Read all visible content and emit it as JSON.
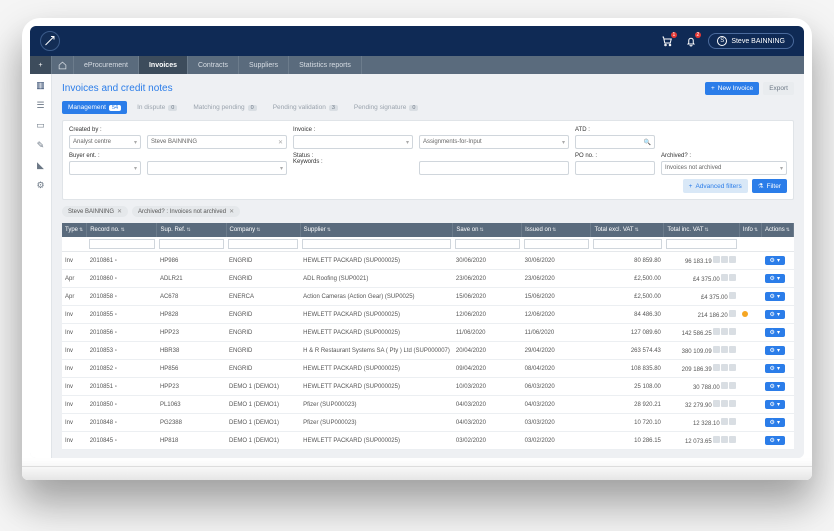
{
  "user": {
    "name": "Steve BAINNING",
    "initial": "S"
  },
  "header": {
    "cart_badge": "1",
    "bell_badge": "2"
  },
  "nav": {
    "items": [
      "eProcurement",
      "Invoices",
      "Contracts",
      "Suppliers",
      "Statistics reports"
    ],
    "active_index": 1
  },
  "sidebar_icons": [
    "clipboard",
    "list-alt",
    "file",
    "pencil",
    "bookmark",
    "gear"
  ],
  "page": {
    "title": "Invoices and credit notes",
    "new_invoice": "New Invoice",
    "export": "Export"
  },
  "tabs": [
    {
      "label": "Management",
      "count": "54"
    },
    {
      "label": "In dispute",
      "count": "0"
    },
    {
      "label": "Matching pending",
      "count": "0"
    },
    {
      "label": "Pending validation",
      "count": "3"
    },
    {
      "label": "Pending signature",
      "count": "0"
    }
  ],
  "filters": {
    "created_by_label": "Created by :",
    "created_by_value": "Analyst centre",
    "buyer_label": "Buyer ent. :",
    "person_value": "Steve BAINNING",
    "invoice_label": "Invoice :",
    "status_label": "Status :",
    "status_value": "Assignments-for-Input",
    "keywords_label": "Keywords :",
    "atd_label": "ATD :",
    "po_label": "PO no. :",
    "archived_label": "Archived? :",
    "archived_value": "Invoices not archived",
    "advanced": "Advanced filters",
    "filter": "Filter"
  },
  "chips": [
    "Steve BAINNING",
    "Archived? : Invoices not archived"
  ],
  "columns": [
    "Type",
    "Record no.",
    "Sup. Ref.",
    "Company",
    "Supplier",
    "Save on",
    "Issued on",
    "Total excl. VAT",
    "Total inc. VAT",
    "Info",
    "Actions"
  ],
  "rows": [
    {
      "type": "Inv",
      "record": "2010861",
      "supref": "HP986",
      "company": "ENGRID",
      "supplier": "HEWLETT PACKARD (SUP000025)",
      "save": "30/06/2020",
      "issued": "30/06/2020",
      "excl": "80 859.80",
      "inc": "96 183.19",
      "info": "",
      "icons": 3
    },
    {
      "type": "Apr",
      "record": "2010860",
      "supref": "ADLR21",
      "company": "ENGRID",
      "supplier": "ADL Roofing (SUP0021)",
      "save": "23/06/2020",
      "issued": "23/06/2020",
      "excl": "£2,500.00",
      "inc": "£4 375.00",
      "info": "",
      "icons": 2
    },
    {
      "type": "Apr",
      "record": "2010858",
      "supref": "AC678",
      "company": "ENERCA",
      "supplier": "Action Cameras (Action Gear) (SUP0025)",
      "save": "15/06/2020",
      "issued": "15/06/2020",
      "excl": "£2,500.00",
      "inc": "£4 375.00",
      "info": "",
      "icons": 1
    },
    {
      "type": "Inv",
      "record": "2010855",
      "supref": "HP828",
      "company": "ENGRID",
      "supplier": "HEWLETT PACKARD (SUP000025)",
      "save": "12/06/2020",
      "issued": "12/06/2020",
      "excl": "84 486.30",
      "inc": "214 186.20",
      "info": "dot",
      "icons": 1
    },
    {
      "type": "Inv",
      "record": "2010856",
      "supref": "HPP23",
      "company": "ENGRID",
      "supplier": "HEWLETT PACKARD (SUP000025)",
      "save": "11/06/2020",
      "issued": "11/06/2020",
      "excl": "127 089.60",
      "inc": "142 586.25",
      "info": "",
      "icons": 3
    },
    {
      "type": "Inv",
      "record": "2010853",
      "supref": "HBR38",
      "company": "ENGRID",
      "supplier": "H & R Restaurant Systems SA ( Pty ) Ltd (SUP000007)",
      "save": "20/04/2020",
      "issued": "29/04/2020",
      "excl": "263 574.43",
      "inc": "380 109.09",
      "info": "",
      "icons": 3
    },
    {
      "type": "Inv",
      "record": "2010852",
      "supref": "HP856",
      "company": "ENGRID",
      "supplier": "HEWLETT PACKARD (SUP000025)",
      "save": "09/04/2020",
      "issued": "08/04/2020",
      "excl": "108 835.80",
      "inc": "209 186.39",
      "info": "",
      "icons": 3
    },
    {
      "type": "Inv",
      "record": "2010851",
      "supref": "HPP23",
      "company": "DEMO 1 (DEMO1)",
      "supplier": "HEWLETT PACKARD (SUP000025)",
      "save": "10/03/2020",
      "issued": "06/03/2020",
      "excl": "25 108.00",
      "inc": "30 788.00",
      "info": "",
      "icons": 2
    },
    {
      "type": "Inv",
      "record": "2010850",
      "supref": "PL1063",
      "company": "DEMO 1 (DEMO1)",
      "supplier": "Pfizer (SUP000023)",
      "save": "04/03/2020",
      "issued": "04/03/2020",
      "excl": "28 920.21",
      "inc": "32 279.90",
      "info": "",
      "icons": 3
    },
    {
      "type": "Inv",
      "record": "2010848",
      "supref": "PG2388",
      "company": "DEMO 1 (DEMO1)",
      "supplier": "Pfizer (SUP000023)",
      "save": "04/03/2020",
      "issued": "03/03/2020",
      "excl": "10 720.10",
      "inc": "12 328.10",
      "info": "",
      "icons": 2
    },
    {
      "type": "Inv",
      "record": "2010845",
      "supref": "HP818",
      "company": "DEMO 1 (DEMO1)",
      "supplier": "HEWLETT PACKARD (SUP000025)",
      "save": "03/02/2020",
      "issued": "03/02/2020",
      "excl": "10 286.15",
      "inc": "12 073.65",
      "info": "",
      "icons": 3
    }
  ]
}
